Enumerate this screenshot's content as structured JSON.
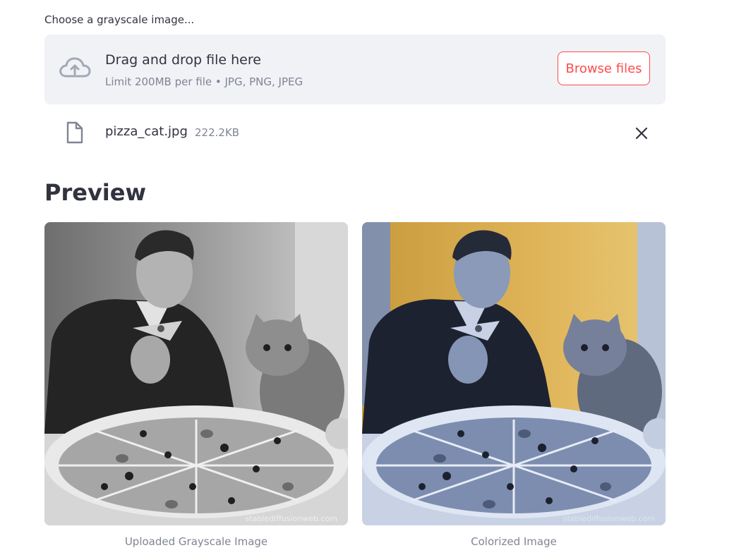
{
  "uploader": {
    "label": "Choose a grayscale image...",
    "drop_title": "Drag and drop file here",
    "drop_sub": "Limit 200MB per file • JPG, PNG, JPEG",
    "browse_label": "Browse files"
  },
  "file": {
    "name": "pizza_cat.jpg",
    "size": "222.2KB"
  },
  "preview": {
    "title": "Preview",
    "images": [
      {
        "caption": "Uploaded Grayscale Image",
        "watermark": "stablediffusionweb.com"
      },
      {
        "caption": "Colorized Image",
        "watermark": "stablediffusionweb.com"
      }
    ]
  },
  "colors": {
    "accent": "#ff4b4b",
    "dropzone_bg": "#f0f2f6",
    "muted_text": "#808495",
    "text": "#31333f"
  },
  "icons": [
    "cloud-upload-icon",
    "file-icon",
    "close-icon"
  ]
}
